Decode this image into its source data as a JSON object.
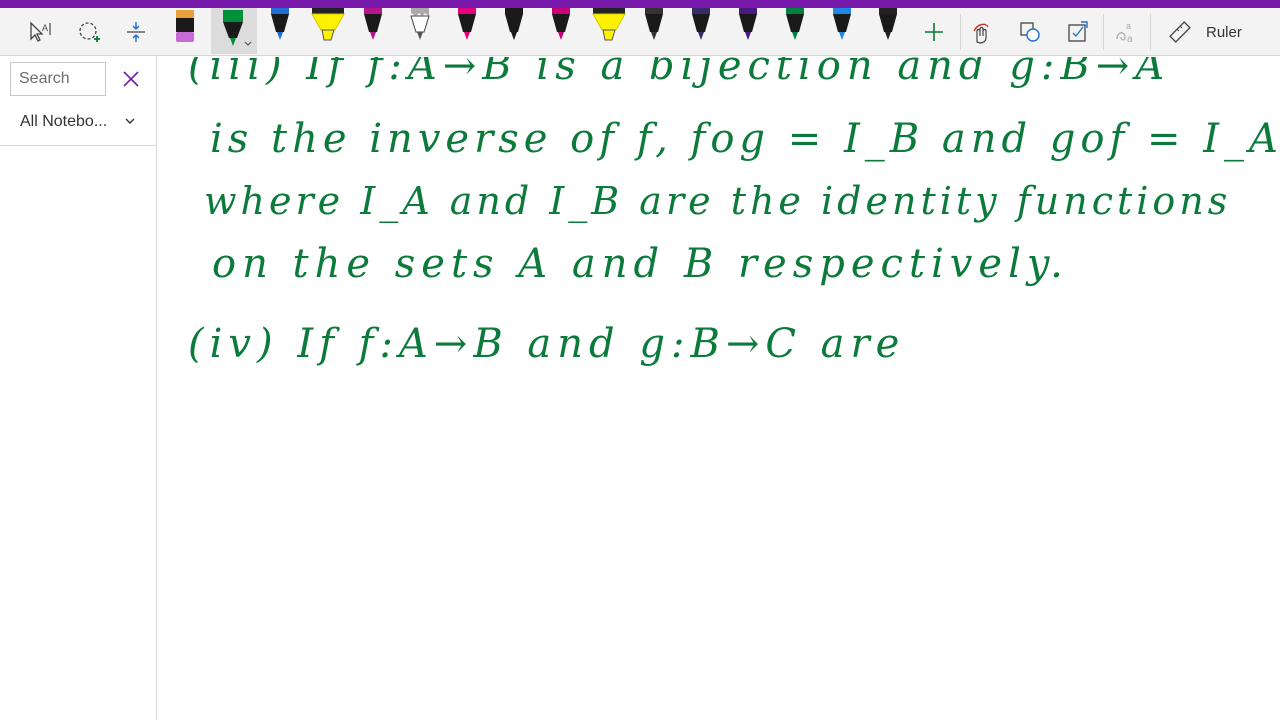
{
  "toolbar": {
    "ruler_label": "Ruler",
    "pens": [
      {
        "color": "#000000",
        "tip": "#c86bd6",
        "kind": "eraser"
      },
      {
        "color": "#008f3a",
        "tip": "#008f3a",
        "kind": "pen",
        "selected": true
      },
      {
        "color": "#1a1a1a",
        "tip": "#1f6fd6",
        "kind": "pen"
      },
      {
        "color": "#fff200",
        "tip": "#f5e600",
        "kind": "highlighter"
      },
      {
        "color": "#1a1a1a",
        "tip": "#b4148c",
        "kind": "pen"
      },
      {
        "color": "#999999",
        "tip": "#666666",
        "kind": "pencil"
      },
      {
        "color": "#1a1a1a",
        "tip": "#e6007a",
        "kind": "pen"
      },
      {
        "color": "#1a1a1a",
        "tip": "#1a1a1a",
        "kind": "pen"
      },
      {
        "color": "#1a1a1a",
        "tip": "#c8007a",
        "kind": "pen"
      },
      {
        "color": "#fff200",
        "tip": "#f5e600",
        "kind": "highlighter"
      },
      {
        "color": "#1a1a1a",
        "tip": "#333333",
        "kind": "pen"
      },
      {
        "color": "#1a1a1a",
        "tip": "#3a2a6a",
        "kind": "pen"
      },
      {
        "color": "#1a1a1a",
        "tip": "#4a1a80",
        "kind": "pen"
      },
      {
        "color": "#1a1a1a",
        "tip": "#00843d",
        "kind": "pen"
      },
      {
        "color": "#1a1a1a",
        "tip": "#1e88e5",
        "kind": "pen"
      },
      {
        "color": "#1a1a1a",
        "tip": "#222222",
        "kind": "pen"
      }
    ]
  },
  "sidebar": {
    "search_placeholder": "Search",
    "scope_label": "All Notebo..."
  },
  "ink": {
    "color": "#0b7a3b",
    "lines": [
      "(iii) If f:A→B is a bijection and g:B→A",
      "is the inverse of f, fog = I_B and gof = I_A.",
      "where I_A and I_B are the identity functions",
      "on the sets A and B respectively.",
      "(iv) If f:A→B and g:B→C are"
    ]
  }
}
